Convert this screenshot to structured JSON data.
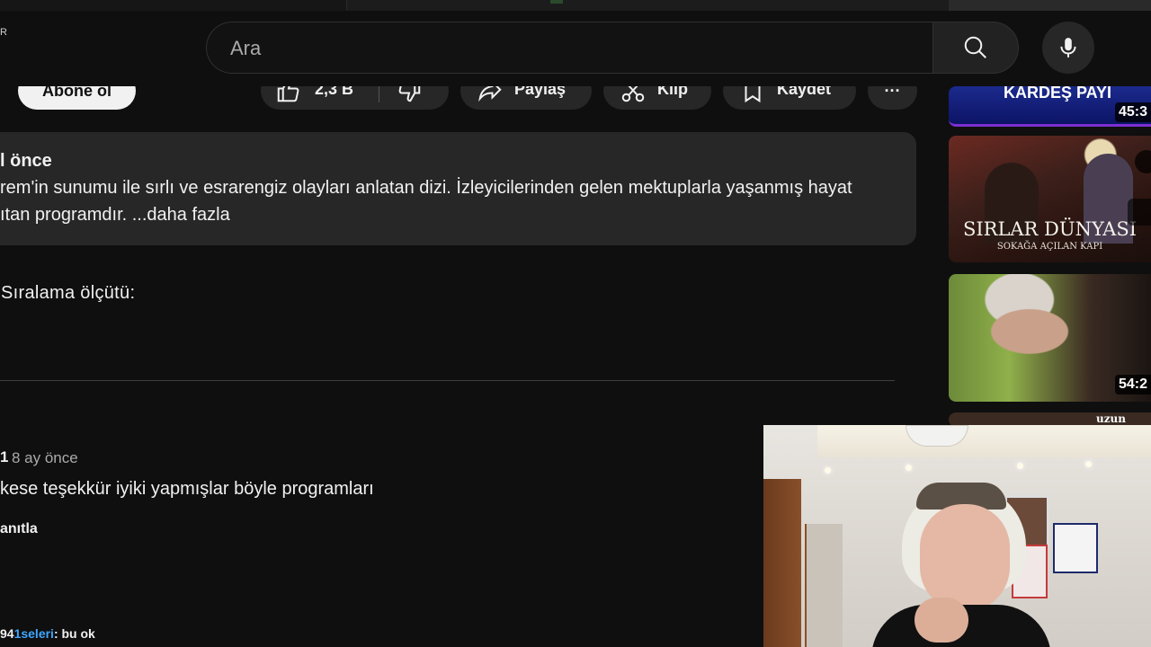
{
  "header": {
    "search_placeholder": "Ara",
    "corner_letter": "R"
  },
  "actions": {
    "subscribe_label": "Abone ol",
    "like_count": "2,3 B",
    "share_label": "Paylaş",
    "clip_label": "Klip",
    "save_label": "Kaydet",
    "more_label": "···"
  },
  "description": {
    "meta": "l önce",
    "line1": "rem'in sunumu ile sırlı ve esrarengiz olayları anlatan dizi. İzleyicilerinden gelen mektuplarla yaşanmış hayat",
    "line2": "ıtan programdır.  ...daha fazla"
  },
  "comments": {
    "sort_label": "Sıralama ölçütü:",
    "items": [
      {
        "user": "1",
        "date": "8 ay önce",
        "text": "kese teşekkür iyiki yapmışlar böyle programları",
        "reply_label": "anıtla"
      }
    ],
    "bottom_fragment_prefix": "94",
    "bottom_fragment_blue": "1seleri",
    "bottom_fragment_suffix": ": bu ok"
  },
  "recommended": [
    {
      "title": "KARDEŞ PAYI",
      "duration": "45:3"
    },
    {
      "title": "SIRLAR DÜNYASI",
      "subtitle": "SOKAĞA AÇILAN KAPI"
    },
    {
      "duration": "54:2"
    },
    {
      "tag": "uzun versi"
    }
  ],
  "colors": {
    "background": "#0f0f0f",
    "surface": "#272727",
    "text_primary": "#f1f1f1",
    "text_secondary": "#aaaaaa",
    "link_blue": "#3ea6ff"
  }
}
